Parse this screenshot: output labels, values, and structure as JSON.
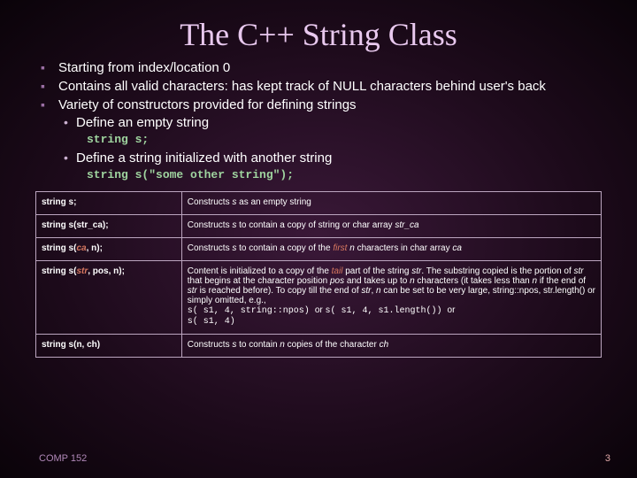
{
  "title": "The C++ String Class",
  "bullets": {
    "b1_1": "Starting from index/location 0",
    "b1_2": "Contains all valid characters: has kept track of NULL characters behind user's back",
    "b1_3": "Variety of constructors provided for defining strings",
    "b2_1": "Define an empty string",
    "code1": "string s;",
    "b2_2": "Define a string initialized with another string",
    "code2": "string s(\"some other string\");"
  },
  "table": {
    "r1": {
      "l": "string s;",
      "r_pre": "Constructs ",
      "r_s": "s ",
      "r_post": "as an empty string"
    },
    "r2": {
      "l": "string s(str_ca);",
      "r_pre": "Constructs ",
      "r_s": "s ",
      "r_mid": "to contain a copy of string or char array ",
      "r_it": "str_ca"
    },
    "r3": {
      "l_pre": "string s(",
      "l_red": "ca",
      "l_post": ", n);",
      "r_pre": "Constructs ",
      "r_s": "s ",
      "r_mid": "to contain a copy of the ",
      "r_red": "first",
      "r_sp": " ",
      "r_n": "n ",
      "r_mid2": "characters in char array ",
      "r_it": "ca"
    },
    "r4": {
      "l_pre": "string s(",
      "l_red": "str",
      "l_post": ", pos, n);",
      "r_1": "Content is initialized to a copy of the ",
      "r_red": "tail",
      "r_2": " part of the string ",
      "r_str": "str",
      "r_3": ". The substring copied is the portion of ",
      "r_str2": "str ",
      "r_4": "that begins at the character position ",
      "r_pos": "pos ",
      "r_5": "and takes up to ",
      "r_n": "n ",
      "r_6": "characters (it takes less than ",
      "r_n2": "n ",
      "r_7": "if the end of ",
      "r_str3": "str ",
      "r_8": "is reached before). To copy till the end of ",
      "r_str4": "str",
      "r_9": ", ",
      "r_n3": "n ",
      "r_10": "can be set to be very large, string::npos, str.length() or simply omitted, e.g.,",
      "r_code1": "s( s1, 4, string::npos) ",
      "r_or1": "or ",
      "r_code2": "s( s1, 4, s1.length()) ",
      "r_or2": "or",
      "r_code3": "s( s1, 4)"
    },
    "r5": {
      "l": "string s(n, ch)",
      "r_pre": "Constructs ",
      "r_s": "s ",
      "r_mid": "to contain ",
      "r_n": "n ",
      "r_mid2": "copies of the character ",
      "r_it": "ch"
    }
  },
  "footer": {
    "left": "COMP 152",
    "right": "3"
  }
}
